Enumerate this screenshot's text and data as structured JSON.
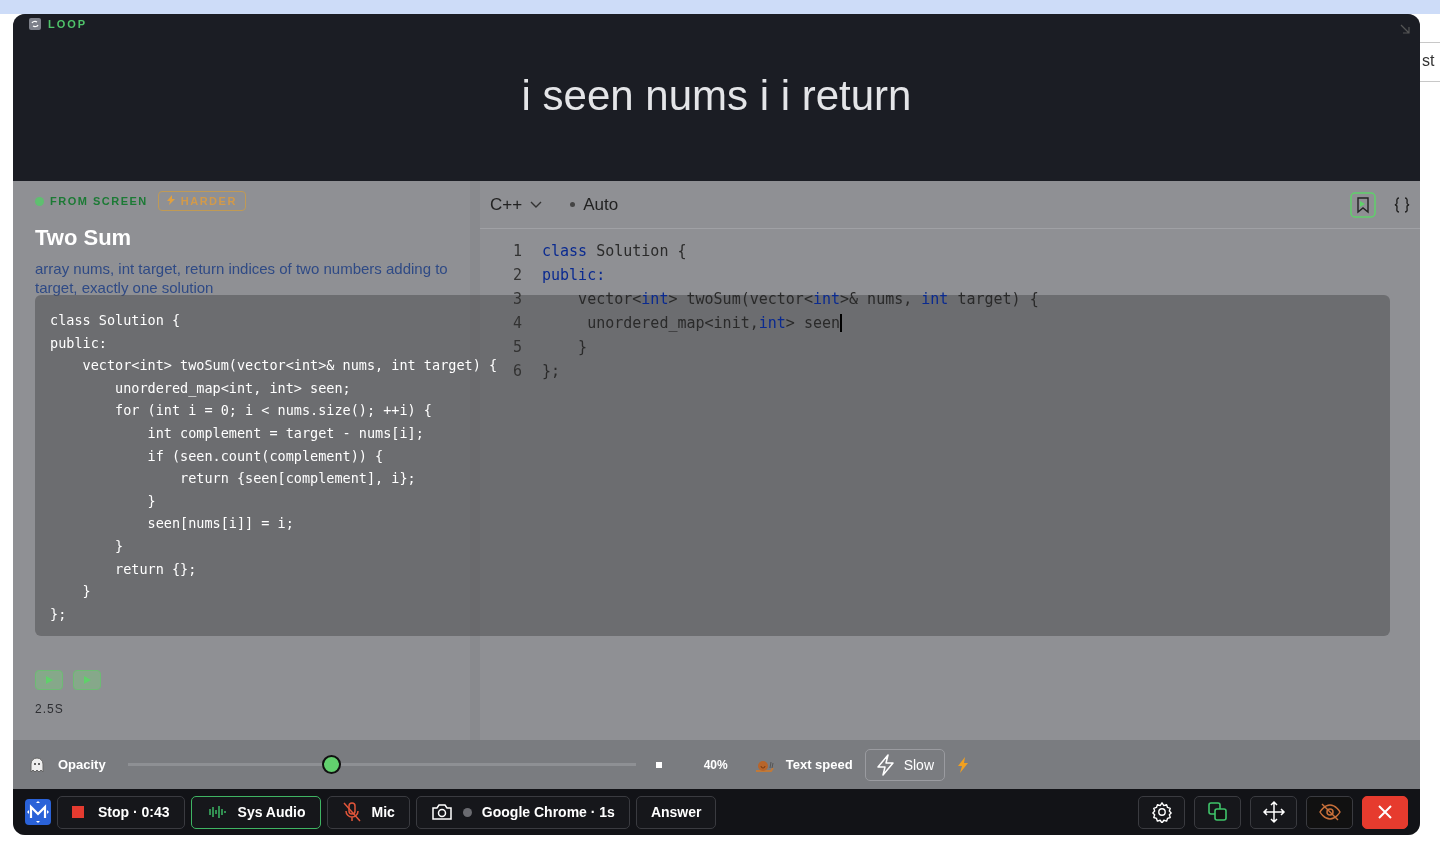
{
  "background_page": {
    "guest_button": "st"
  },
  "app": {
    "name": "LOOP"
  },
  "caption": "i seen nums i i return",
  "problem": {
    "badges": [
      {
        "label": "FROM SCREEN",
        "kind": "source"
      },
      {
        "label": "HARDER",
        "kind": "difficulty"
      }
    ],
    "title": "Two Sum",
    "summary": "array nums, int target, return indices of two numbers adding to target, exactly one solution",
    "run_time": "2.5S"
  },
  "answer_code": [
    "class Solution {",
    "public:",
    "    vector<int> twoSum(vector<int>& nums, int target) {",
    "        unordered_map<int, int> seen;",
    "        for (int i = 0; i < nums.size(); ++i) {",
    "            int complement = target - nums[i];",
    "            if (seen.count(complement)) {",
    "                return {seen[complement], i};",
    "            }",
    "            seen[nums[i]] = i;",
    "        }",
    "        return {};",
    "    }",
    "};"
  ],
  "editor": {
    "language": "C++",
    "mode": "Auto",
    "lines": [
      {
        "number": "1",
        "tokens": [
          {
            "text": "class",
            "kind": "keyword"
          },
          {
            "text": " Solution {",
            "kind": "plain"
          }
        ]
      },
      {
        "number": "2",
        "tokens": [
          {
            "text": "public:",
            "kind": "keyword"
          }
        ]
      },
      {
        "number": "3",
        "tokens": [
          {
            "text": "    vector<",
            "kind": "plain"
          },
          {
            "text": "int",
            "kind": "keyword"
          },
          {
            "text": "> twoSum(vector<",
            "kind": "plain"
          },
          {
            "text": "int",
            "kind": "keyword"
          },
          {
            "text": ">& nums, ",
            "kind": "plain"
          },
          {
            "text": "int",
            "kind": "keyword"
          },
          {
            "text": " target) {",
            "kind": "plain"
          }
        ]
      },
      {
        "number": "4",
        "tokens": [
          {
            "text": "     unordered_map<init,",
            "kind": "plain"
          },
          {
            "text": "int",
            "kind": "keyword"
          },
          {
            "text": "> seen",
            "kind": "plain"
          }
        ],
        "cursor": true
      },
      {
        "number": "5",
        "tokens": [
          {
            "text": "    }",
            "kind": "plain"
          }
        ]
      },
      {
        "number": "6",
        "tokens": [
          {
            "text": "};",
            "kind": "plain"
          }
        ]
      }
    ]
  },
  "controls": {
    "opacity": {
      "label": "Opacity",
      "level": 0.4,
      "reading": "40%"
    },
    "text_speed": {
      "label": "Text speed",
      "value": "Slow"
    }
  },
  "toolbar": {
    "record": "Stop · 0:43",
    "sys_audio": {
      "label": "Sys Audio",
      "on": true
    },
    "mic": {
      "label": "Mic",
      "on": false
    },
    "capture": "Google Chrome · 1s",
    "answer": "Answer"
  }
}
